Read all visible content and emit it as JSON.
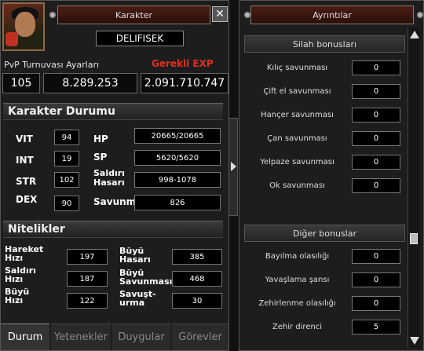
{
  "character_window": {
    "title": "Karakter",
    "name": "DELIFISEK",
    "pvp_label": "PvP Turnuvası Ayarları",
    "pvp_value": "105",
    "exp_value": "8.289.253",
    "required_exp_label": "Gerekli EXP",
    "required_exp_value": "2.091.710.747",
    "status_header": "Karakter Durumu",
    "stats": {
      "vit_label": "VIT",
      "vit": "94",
      "int_label": "INT",
      "int": "19",
      "str_label": "STR",
      "str": "102",
      "dex_label": "DEX",
      "dex": "90",
      "hp_label": "HP",
      "hp": "20665/20665",
      "sp_label": "SP",
      "sp": "5620/5620",
      "attack_label_1": "Saldırı",
      "attack_label_2": "Hasarı",
      "attack": "998-1078",
      "defense_label": "Savunm",
      "defense": "826"
    },
    "attributes_header": "Nitelikler",
    "attributes": {
      "move_speed_1": "Hareket",
      "move_speed_2": "Hızı",
      "move_speed": "197",
      "attack_speed_1": "Saldırı",
      "attack_speed_2": "Hızı",
      "attack_speed": "187",
      "magic_speed_1": "Büyü",
      "magic_speed_2": "Hızı",
      "magic_speed": "122",
      "magic_attack_1": "Büyü",
      "magic_attack_2": "Hasarı",
      "magic_attack": "385",
      "magic_defense_1": "Büyü",
      "magic_defense_2": "Savunması",
      "magic_defense": "468",
      "dodge_1": "Savuşt-",
      "dodge_2": "urma",
      "dodge": "30"
    },
    "tabs": [
      "Durum",
      "Yetenekler",
      "Duygular",
      "Görevler"
    ]
  },
  "detail_window": {
    "title": "Ayrıntılar",
    "weapon_header": "Silah bonusları",
    "weapon_rows": [
      {
        "label": "Kılıç savunması",
        "value": "0"
      },
      {
        "label": "Çift el savunması",
        "value": "0"
      },
      {
        "label": "Hançer savunması",
        "value": "0"
      },
      {
        "label": "Çan savunması",
        "value": "0"
      },
      {
        "label": "Yelpaze savunması",
        "value": "0"
      },
      {
        "label": "Ok savunması",
        "value": "0"
      }
    ],
    "other_header": "Diğer bonuslar",
    "other_rows": [
      {
        "label": "Bayılma olasılığı",
        "value": "0"
      },
      {
        "label": "Yavaşlama şansı",
        "value": "0"
      },
      {
        "label": "Zehirlenme olasılığı",
        "value": "0"
      },
      {
        "label": "Zehir direnci",
        "value": "5"
      }
    ]
  },
  "colors": {
    "accent_red": "#e0301c",
    "title_bar": "#3a150e"
  }
}
